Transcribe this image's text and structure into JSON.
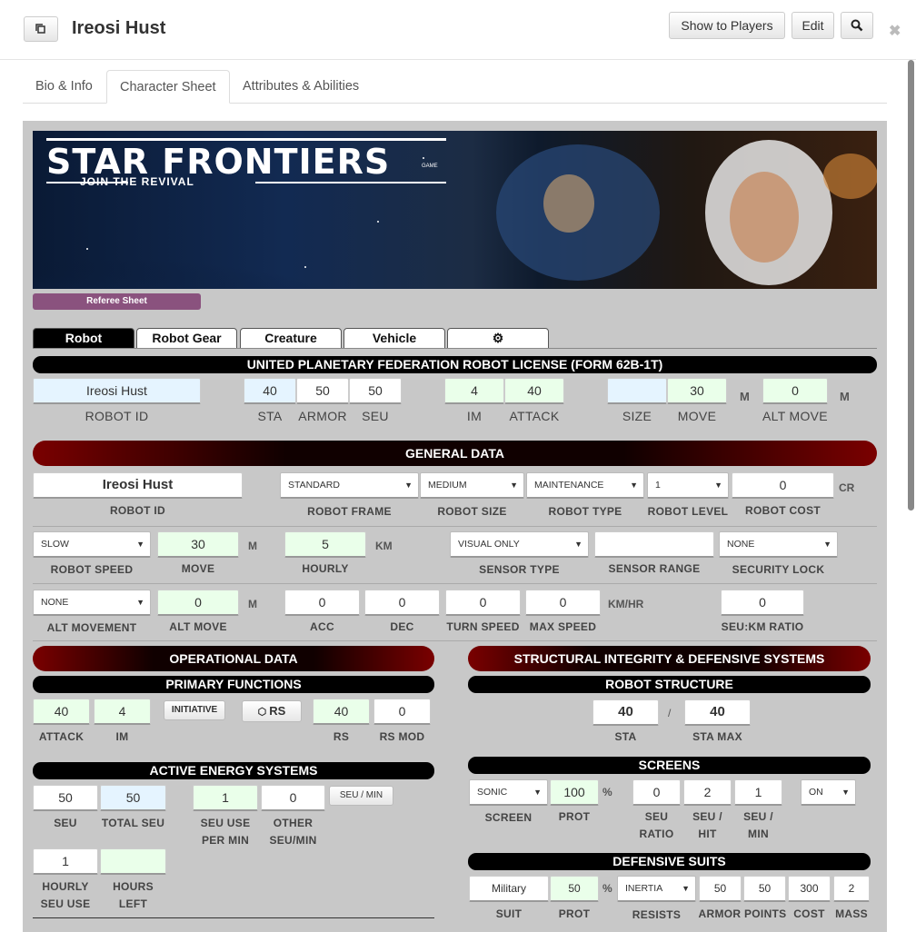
{
  "header": {
    "title": "Ireosi Hust",
    "show_players": "Show to Players",
    "edit": "Edit"
  },
  "tabs": [
    {
      "label": "Bio & Info"
    },
    {
      "label": "Character Sheet"
    },
    {
      "label": "Attributes & Abilities"
    }
  ],
  "banner": {
    "title": "STAR FRONTIERS",
    "tm": "GAME",
    "tagline": "JOIN THE REVIVAL",
    "referee_button": "Referee Sheet"
  },
  "robot_tabs": [
    {
      "label": "Robot"
    },
    {
      "label": "Robot Gear"
    },
    {
      "label": "Creature"
    },
    {
      "label": "Vehicle"
    }
  ],
  "license": {
    "title": "UNITED PLANETARY FEDERATION ROBOT LICENSE (FORM 62B-1T)",
    "robot_id": "Ireosi Hust",
    "robot_id_label": "ROBOT ID",
    "sta": "40",
    "sta_label": "STA",
    "armor": "50",
    "armor_label": "ARMOR",
    "seu": "50",
    "seu_label": "SEU",
    "im": "4",
    "im_label": "IM",
    "attack": "40",
    "attack_label": "ATTACK",
    "size": "",
    "size_label": "SIZE",
    "move": "30",
    "move_label": "MOVE",
    "move_unit": "M",
    "alt_move": "0",
    "alt_move_label": "ALT MOVE",
    "alt_move_unit": "M"
  },
  "general": {
    "title": "GENERAL DATA",
    "robot_id": "Ireosi Hust",
    "robot_id_label": "ROBOT ID",
    "frame": "STANDARD",
    "frame_label": "ROBOT FRAME",
    "size": "MEDIUM",
    "size_label": "ROBOT SIZE",
    "type": "MAINTENANCE",
    "type_label": "ROBOT TYPE",
    "level": "1",
    "level_label": "ROBOT LEVEL",
    "cost": "0",
    "cost_label": "ROBOT COST",
    "cost_unit": "CR",
    "speed": "SLOW",
    "speed_label": "ROBOT SPEED",
    "move": "30",
    "move_label": "MOVE",
    "move_unit": "M",
    "hourly": "5",
    "hourly_label": "HOURLY",
    "hourly_unit": "KM",
    "sensor_type": "VISUAL ONLY",
    "sensor_type_label": "SENSOR TYPE",
    "sensor_range": "",
    "sensor_range_label": "SENSOR RANGE",
    "security_lock": "NONE",
    "security_lock_label": "SECURITY LOCK",
    "alt_movement": "NONE",
    "alt_movement_label": "ALT MOVEMENT",
    "alt_move": "0",
    "alt_move_label": "ALT MOVE",
    "alt_move_unit": "M",
    "acc": "0",
    "acc_label": "ACC",
    "dec": "0",
    "dec_label": "DEC",
    "turn_speed": "0",
    "turn_speed_label": "TURN SPEED",
    "max_speed": "0",
    "max_speed_label": "MAX SPEED",
    "speed_unit": "KM/HR",
    "seu_km": "0",
    "seu_km_label": "SEU:KM RATIO"
  },
  "operational": {
    "title": "OPERATIONAL DATA",
    "primary_title": "PRIMARY FUNCTIONS",
    "attack": "40",
    "attack_label": "ATTACK",
    "im": "4",
    "im_label": "IM",
    "initiative": "INITIATIVE",
    "rs_button": "RS",
    "rs": "40",
    "rs_label": "RS",
    "rs_mod": "0",
    "rs_mod_label": "RS MOD",
    "energy_title": "ACTIVE ENERGY SYSTEMS",
    "seu": "50",
    "seu_label": "SEU",
    "total_seu": "50",
    "total_seu_label": "TOTAL SEU",
    "seu_use": "1",
    "seu_use_label1": "SEU USE",
    "seu_use_label2": "PER MIN",
    "other_seu": "0",
    "other_seu_label1": "OTHER",
    "other_seu_label2": "SEU/MIN",
    "seu_min_button": "SEU / MIN",
    "hourly_seu": "1",
    "hourly_seu_label1": "HOURLY",
    "hourly_seu_label2": "SEU USE",
    "hours_left": "",
    "hours_left_label1": "HOURS",
    "hours_left_label2": "LEFT"
  },
  "structural": {
    "title": "STRUCTURAL INTEGRITY & DEFENSIVE SYSTEMS",
    "structure_title": "ROBOT STRUCTURE",
    "sta": "40",
    "sta_label": "STA",
    "slash": "/",
    "sta_max": "40",
    "sta_max_label": "STA MAX",
    "screens_title": "SCREENS",
    "screen": "SONIC",
    "screen_label": "SCREEN",
    "prot": "100",
    "prot_label": "PROT",
    "pct": "%",
    "seu_ratio": "0",
    "seu_ratio_label1": "SEU",
    "seu_ratio_label2": "RATIO",
    "seu_hit": "2",
    "seu_hit_label1": "SEU /",
    "seu_hit_label2": "HIT",
    "seu_min": "1",
    "seu_min_label1": "SEU /",
    "seu_min_label2": "MIN",
    "screen_on": "ON",
    "suits_title": "DEFENSIVE SUITS",
    "suit": "Military",
    "suit_label": "SUIT",
    "suit_prot": "50",
    "suit_prot_label": "PROT",
    "resists": "INERTIA",
    "resists_label": "RESISTS",
    "armor1": "50",
    "armor2": "50",
    "armor_label": "ARMOR POINTS",
    "cost": "300",
    "cost_label": "COST",
    "mass": "2",
    "mass_label": "MASS"
  }
}
